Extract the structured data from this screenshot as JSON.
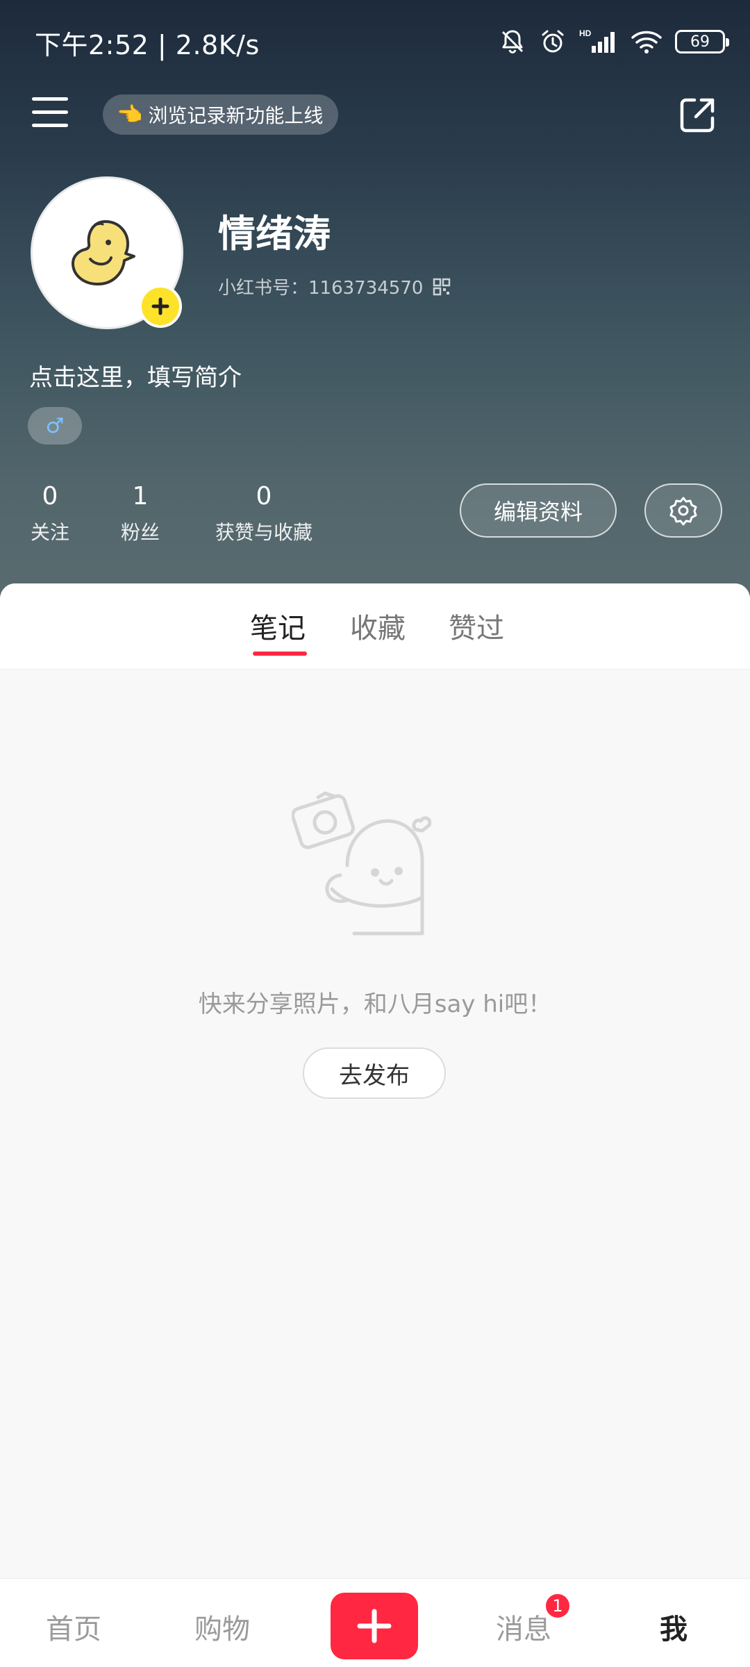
{
  "status_bar": {
    "time": "下午2:52 | 2.8K/s",
    "battery": "69",
    "icons": [
      "mute-bell-icon",
      "alarm-icon",
      "hd-signal-icon",
      "wifi-icon",
      "battery-icon"
    ]
  },
  "header": {
    "menu_icon": "menu-icon",
    "notice_emoji": "👈",
    "notice": "浏览记录新功能上线",
    "share_icon": "share-icon"
  },
  "profile": {
    "nickname": "情绪涛",
    "id_label": "小红书号：1163734570",
    "bio": "点击这里，填写简介",
    "gender": "♂",
    "stats": [
      {
        "num": "0",
        "label": "关注"
      },
      {
        "num": "1",
        "label": "粉丝"
      },
      {
        "num": "0",
        "label": "获赞与收藏"
      }
    ],
    "edit_button": "编辑资料",
    "settings_icon": "gear-icon"
  },
  "tabs": [
    {
      "label": "笔记",
      "active": true
    },
    {
      "label": "收藏",
      "active": false
    },
    {
      "label": "赞过",
      "active": false
    }
  ],
  "empty_state": {
    "message": "快来分享照片，和八月say hi吧！",
    "button": "去发布"
  },
  "bottom_nav": {
    "items": [
      {
        "label": "首页",
        "active": false
      },
      {
        "label": "购物",
        "active": false
      },
      {
        "label": "消息",
        "active": false,
        "badge": "1"
      },
      {
        "label": "我",
        "active": true
      }
    ],
    "publish_icon": "plus-icon"
  },
  "colors": {
    "accent": "#ff2741",
    "avatar_badge": "#fde22a",
    "gender_male": "#7ec2ff"
  }
}
